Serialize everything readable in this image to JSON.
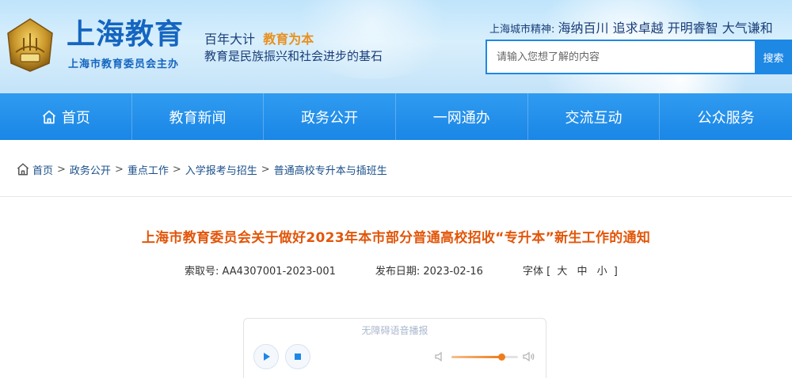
{
  "header": {
    "site_title": "上海教育",
    "site_subtitle": "上海市教育委员会主办",
    "slogan_part1": "百年大计",
    "slogan_part2": "教育为本",
    "slogan_line2": "教育是民族振兴和社会进步的基石",
    "spirit_label": "上海城市精神:",
    "spirit_text": "海纳百川 追求卓越 开明睿智 大气谦和",
    "search": {
      "placeholder": "请输入您想了解的内容",
      "button_label": "搜索"
    }
  },
  "nav": {
    "items": [
      {
        "label": "首页",
        "icon": "home-icon"
      },
      {
        "label": "教育新闻"
      },
      {
        "label": "政务公开"
      },
      {
        "label": "一网通办"
      },
      {
        "label": "交流互动"
      },
      {
        "label": "公众服务"
      }
    ]
  },
  "breadcrumb": {
    "icon": "home-icon",
    "items": [
      "首页",
      "政务公开",
      "重点工作",
      "入学报考与招生",
      "普通高校专升本与插班生"
    ]
  },
  "article": {
    "title": "上海市教育委员会关于做好2023年本市部分普通高校招收“专升本”新生工作的通知",
    "index_label": "索取号:",
    "index_value": "AA4307001-2023-001",
    "date_label": "发布日期:",
    "date_value": "2023-02-16",
    "font_label": "字体",
    "font_open": "[",
    "font_large": "大",
    "font_medium": "中",
    "font_small": "小",
    "font_close": "]"
  },
  "player": {
    "label": "无障碍语音播报",
    "volume_level": 0.75,
    "accent_color": "#ef7c1a"
  },
  "colors": {
    "brand_blue": "#1e88e5",
    "title_orange": "#e2560a",
    "slogan_highlight": "#e89020"
  }
}
